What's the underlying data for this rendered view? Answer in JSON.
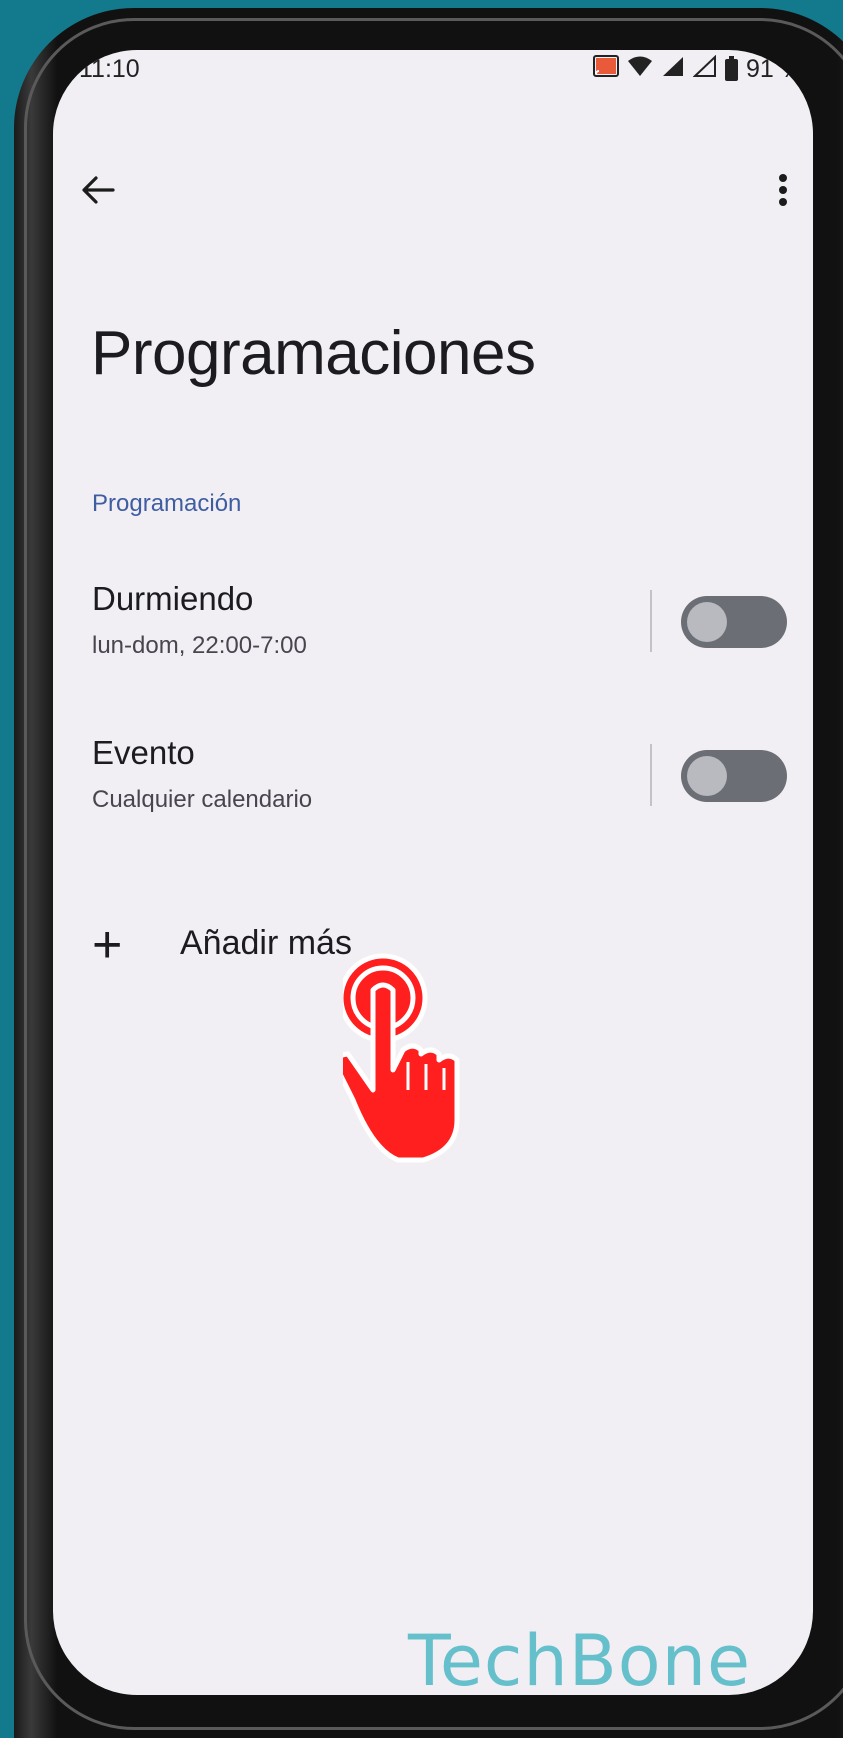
{
  "status_bar": {
    "time": "11:10",
    "battery": "91 %"
  },
  "header": {
    "title": "Programaciones"
  },
  "section": {
    "label": "Programación"
  },
  "schedules": [
    {
      "title": "Durmiendo",
      "subtitle": "lun-dom, 22:00-7:00",
      "enabled": false
    },
    {
      "title": "Evento",
      "subtitle": "Cualquier calendario",
      "enabled": false
    }
  ],
  "add_more": {
    "label": "Añadir más"
  },
  "watermark": "TechBone",
  "colors": {
    "background": "#127a8c",
    "screen": "#f1eff3",
    "accent": "#3f5da1",
    "toggle_off": "#6c6e75",
    "tap_icon": "#ff1f1f",
    "watermark": "#66c0cc"
  }
}
